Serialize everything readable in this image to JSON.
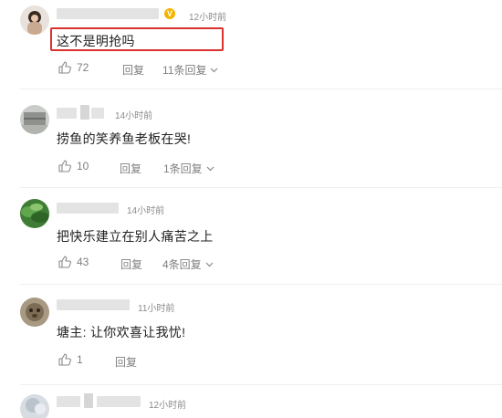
{
  "comments": [
    {
      "time": "12小时前",
      "text": "这不是明抢吗",
      "likes": "72",
      "reply_label": "回复",
      "replies": "11条回复",
      "highlighted": true,
      "verified_badge": "V"
    },
    {
      "time": "14小时前",
      "text": "捞鱼的笑养鱼老板在哭!",
      "likes": "10",
      "reply_label": "回复",
      "replies": "1条回复"
    },
    {
      "time": "14小时前",
      "text": "把快乐建立在别人痛苦之上",
      "likes": "43",
      "reply_label": "回复",
      "replies": "4条回复"
    },
    {
      "time": "11小时前",
      "text": "塘主: 让你欢喜让我忧!",
      "likes": "1",
      "reply_label": "回复"
    },
    {
      "time": "12小时前"
    }
  ],
  "colors": {
    "highlight_border": "#d9322f",
    "muted_text": "#7f7f7f",
    "badge": "#f5b400"
  },
  "icons": {
    "like": "thumbs-up-icon",
    "expand": "chevron-down-icon"
  }
}
